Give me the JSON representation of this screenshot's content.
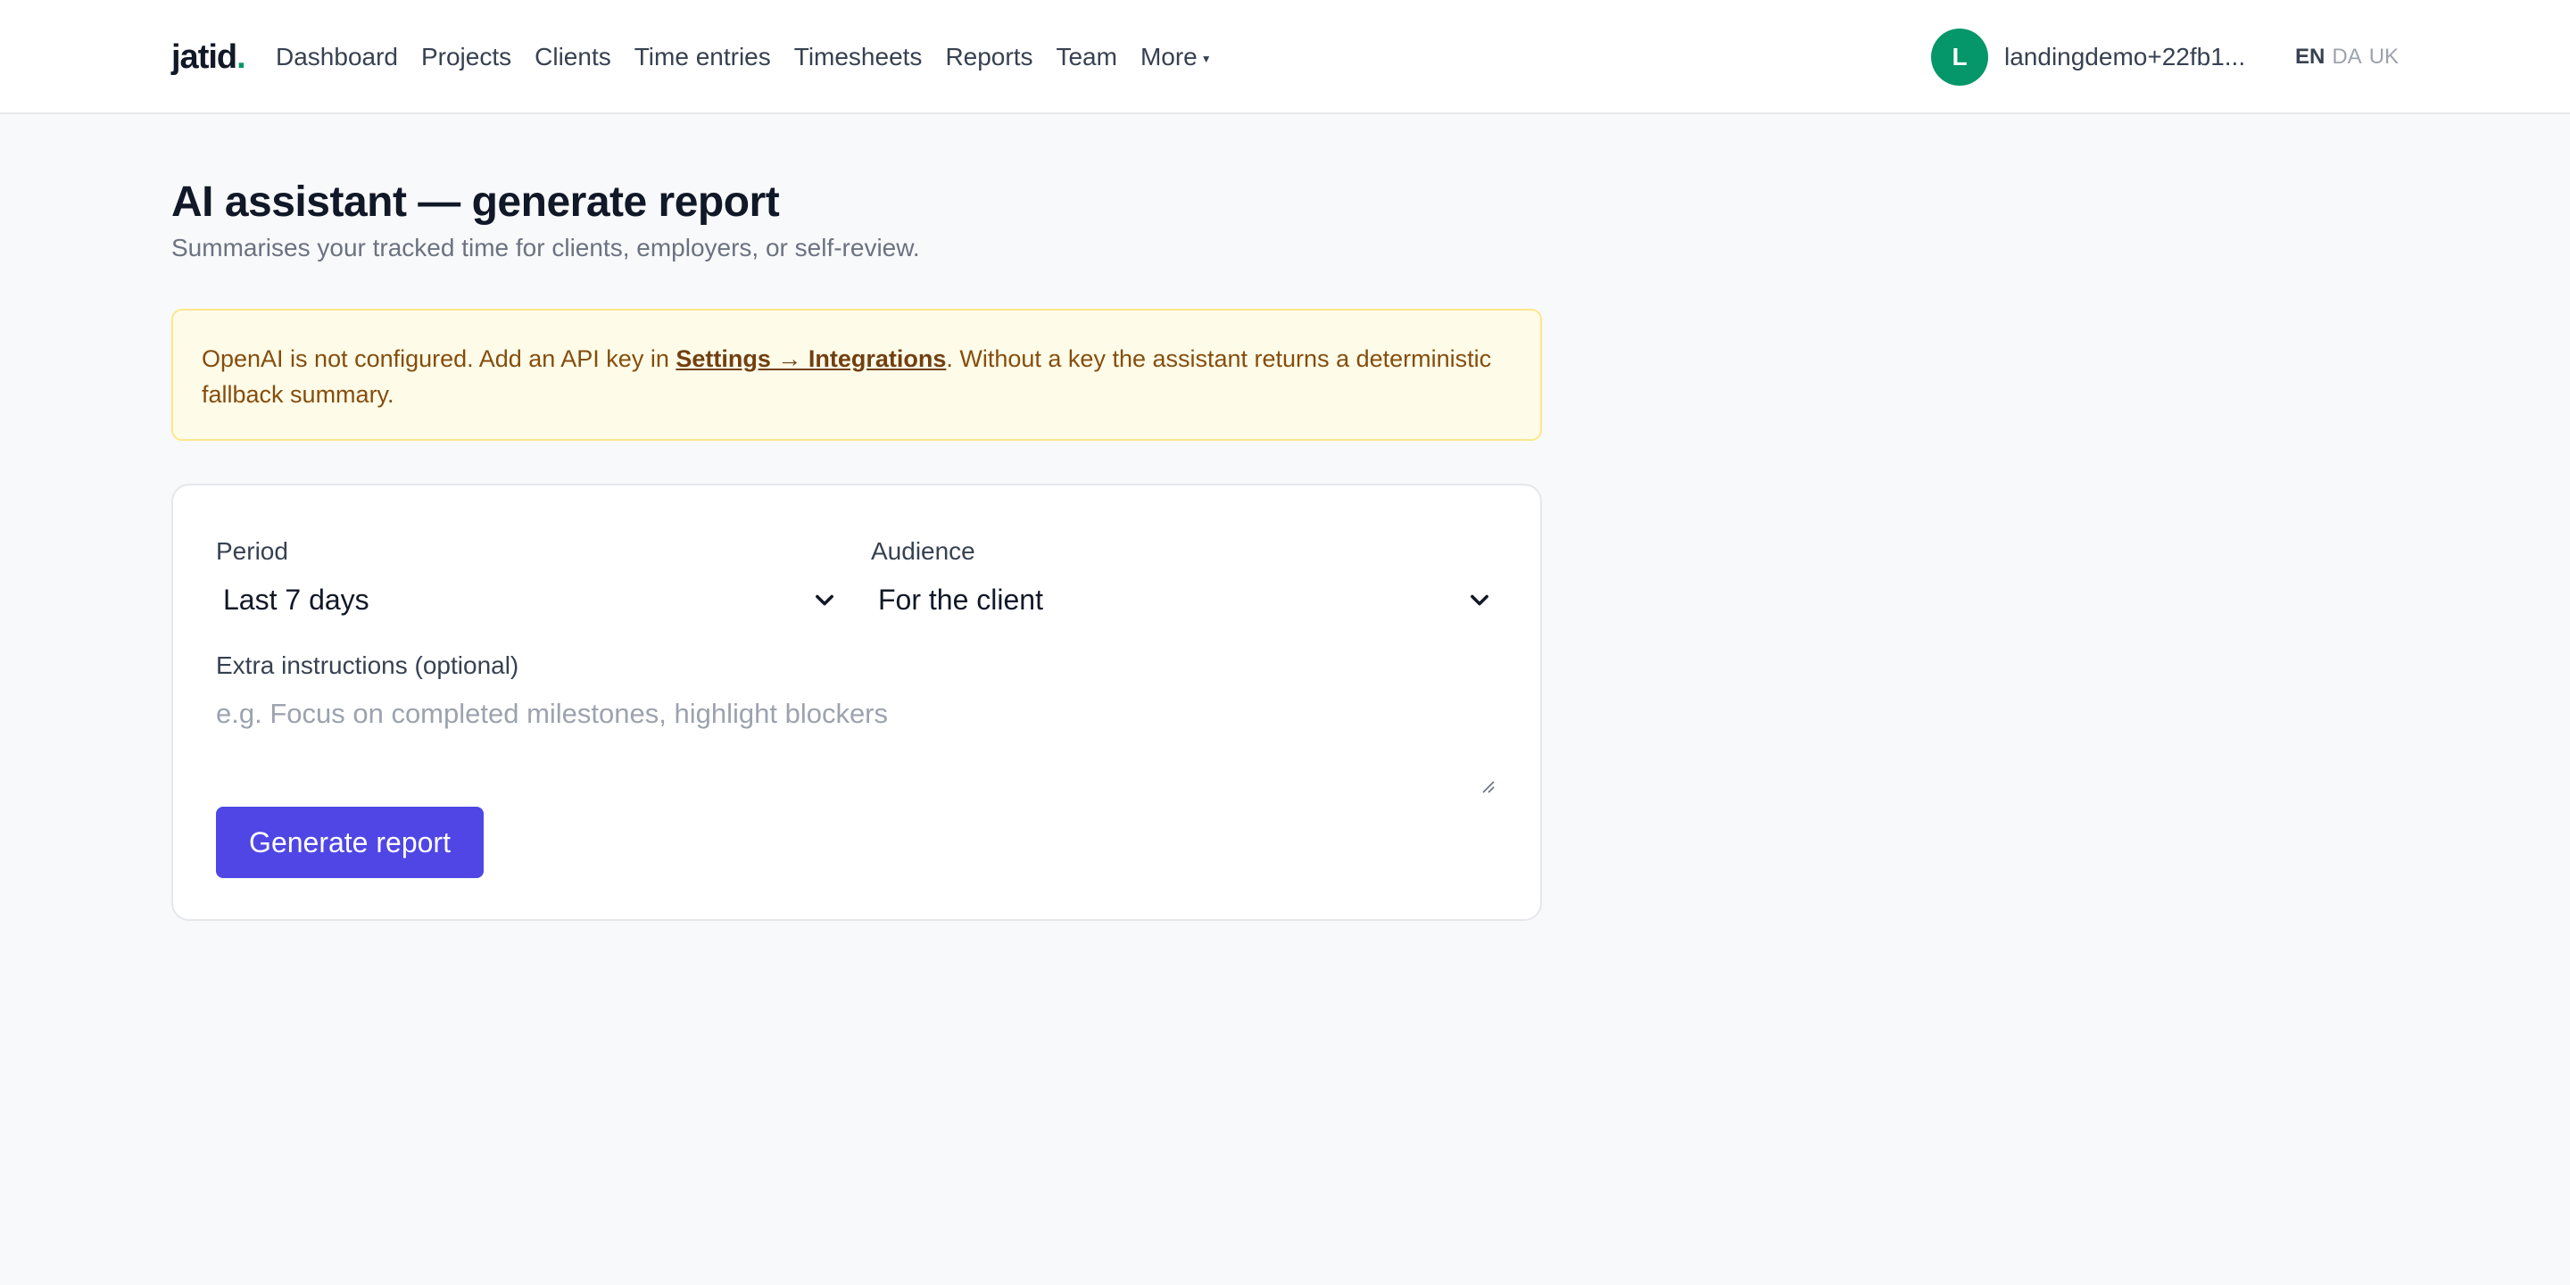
{
  "brand": {
    "name": "jatid",
    "dot": "."
  },
  "nav": {
    "items": [
      {
        "label": "Dashboard"
      },
      {
        "label": "Projects"
      },
      {
        "label": "Clients"
      },
      {
        "label": "Time entries"
      },
      {
        "label": "Timesheets"
      },
      {
        "label": "Reports"
      },
      {
        "label": "Team"
      }
    ],
    "more_label": "More"
  },
  "user": {
    "initial": "L",
    "name": "landingdemo+22fb1...",
    "avatar_color": "#059669"
  },
  "languages": {
    "active": "EN",
    "others": [
      "DA",
      "UK"
    ]
  },
  "page": {
    "title": "AI assistant — generate report",
    "subtitle": "Summarises your tracked time for clients, employers, or self-review."
  },
  "alert": {
    "text_before": "OpenAI is not configured. Add an API key in ",
    "link_label": "Settings → Integrations",
    "text_after": ". Without a key the assistant returns a deterministic fallback summary."
  },
  "form": {
    "period_label": "Period",
    "period_value": "Last 7 days",
    "audience_label": "Audience",
    "audience_value": "For the client",
    "instructions_label": "Extra instructions (optional)",
    "instructions_placeholder": "e.g. Focus on completed milestones, highlight blockers",
    "submit_label": "Generate report"
  },
  "colors": {
    "accent": "#4f46e5",
    "brand_dot": "#059669",
    "alert_bg": "#fefce8",
    "alert_text": "#854d0e"
  }
}
